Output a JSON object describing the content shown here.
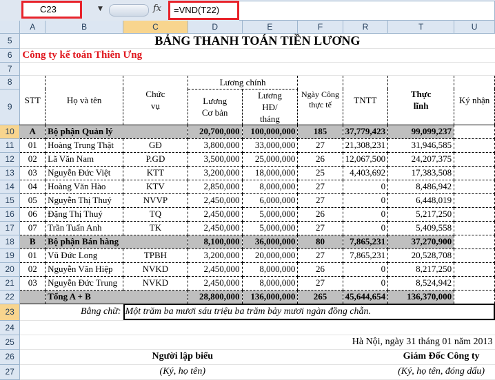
{
  "formula_bar": {
    "name_box": "C23",
    "formula": "=VND(T22)",
    "fx_label": "fx"
  },
  "columns": [
    "A",
    "B",
    "C",
    "D",
    "E",
    "F",
    "R",
    "T",
    "U"
  ],
  "rows": {
    "r5": "5",
    "r6": "6",
    "r7": "7",
    "r8": "8",
    "r9": "9",
    "r10": "10",
    "r11": "11",
    "r12": "12",
    "r13": "13",
    "r14": "14",
    "r15": "15",
    "r16": "16",
    "r17": "17",
    "r18": "18",
    "r19": "19",
    "r20": "20",
    "r21": "21",
    "r22": "22",
    "r23": "23",
    "r24": "24",
    "r25": "25",
    "r26": "26",
    "r27": "27"
  },
  "sheet": {
    "title": "BẢNG THANH TOÁN TIỀN LƯƠNG",
    "company": "Công ty kế toán Thiên Ưng",
    "headers": {
      "stt": "STT",
      "name": "Họ và tên",
      "position": "Chức vụ",
      "main_salary": "Lương chính",
      "basic_salary": "Lương Cơ bản",
      "contract_salary": "Lương HĐ/ tháng",
      "work_days": "Ngày Công thực tế",
      "tntt": "TNTT",
      "net_pay": "Thực lĩnh",
      "signature": "Ký nhận"
    },
    "groups": {
      "a": {
        "code": "A",
        "name": "Bộ phận Quản lý",
        "basic": "20,700,000",
        "contract": "100,000,000",
        "days": "185",
        "tntt": "37,779,423",
        "net": "99,099,237"
      },
      "b": {
        "code": "B",
        "name": "Bộ phận Bán hàng",
        "basic": "8,100,000",
        "contract": "36,000,000",
        "days": "80",
        "tntt": "7,865,231",
        "net": "37,270,900"
      },
      "total": {
        "name": "Tổng A + B",
        "basic": "28,800,000",
        "contract": "136,000,000",
        "days": "265",
        "tntt": "45,644,654",
        "net": "136,370,000"
      }
    },
    "group_a_rows": [
      {
        "stt": "01",
        "name": "Hoàng Trung Thật",
        "pos": "GĐ",
        "basic": "3,800,000",
        "contract": "33,000,000",
        "days": "27",
        "tntt": "21,308,231",
        "net": "31,946,585"
      },
      {
        "stt": "02",
        "name": "Lã Văn Nam",
        "pos": "P.GD",
        "basic": "3,500,000",
        "contract": "25,000,000",
        "days": "26",
        "tntt": "12,067,500",
        "net": "24,207,375"
      },
      {
        "stt": "03",
        "name": "Nguyễn Đức Việt",
        "pos": "KTT",
        "basic": "3,200,000",
        "contract": "18,000,000",
        "days": "25",
        "tntt": "4,403,692",
        "net": "17,383,508"
      },
      {
        "stt": "04",
        "name": "Hoàng Văn Hào",
        "pos": "KTV",
        "basic": "2,850,000",
        "contract": "8,000,000",
        "days": "27",
        "tntt": "0",
        "net": "8,486,942"
      },
      {
        "stt": "05",
        "name": "Nguyễn Thị Thuý",
        "pos": "NVVP",
        "basic": "2,450,000",
        "contract": "6,000,000",
        "days": "27",
        "tntt": "0",
        "net": "6,448,019"
      },
      {
        "stt": "06",
        "name": "Đặng Thị Thuý",
        "pos": "TQ",
        "basic": "2,450,000",
        "contract": "5,000,000",
        "days": "26",
        "tntt": "0",
        "net": "5,217,250"
      },
      {
        "stt": "07",
        "name": "Trần Tuấn Anh",
        "pos": "TK",
        "basic": "2,450,000",
        "contract": "5,000,000",
        "days": "27",
        "tntt": "0",
        "net": "5,409,558"
      }
    ],
    "group_b_rows": [
      {
        "stt": "01",
        "name": "Vũ Đức Long",
        "pos": "TPBH",
        "basic": "3,200,000",
        "contract": "20,000,000",
        "days": "27",
        "tntt": "7,865,231",
        "net": "20,528,708"
      },
      {
        "stt": "02",
        "name": "Nguyễn Văn Hiệp",
        "pos": "NVKD",
        "basic": "2,450,000",
        "contract": "8,000,000",
        "days": "26",
        "tntt": "0",
        "net": "8,217,250"
      },
      {
        "stt": "03",
        "name": "Nguyễn Đức Trung",
        "pos": "NVKD",
        "basic": "2,450,000",
        "contract": "8,000,000",
        "days": "27",
        "tntt": "0",
        "net": "8,524,942"
      }
    ],
    "in_words_label": "Bằng chữ:",
    "in_words_value": "Một trăm ba mươi sáu triệu ba trăm bảy mươi ngàn đồng chẵn.",
    "date_line": "Hà Nội, ngày 31 tháng 01 năm 2013",
    "preparer_title": "Người lập biểu",
    "preparer_note": "(Ký, họ tên)",
    "director_title": "Giám Đốc Công ty",
    "director_note": "(Ký, họ tên, đóng dấu)"
  }
}
